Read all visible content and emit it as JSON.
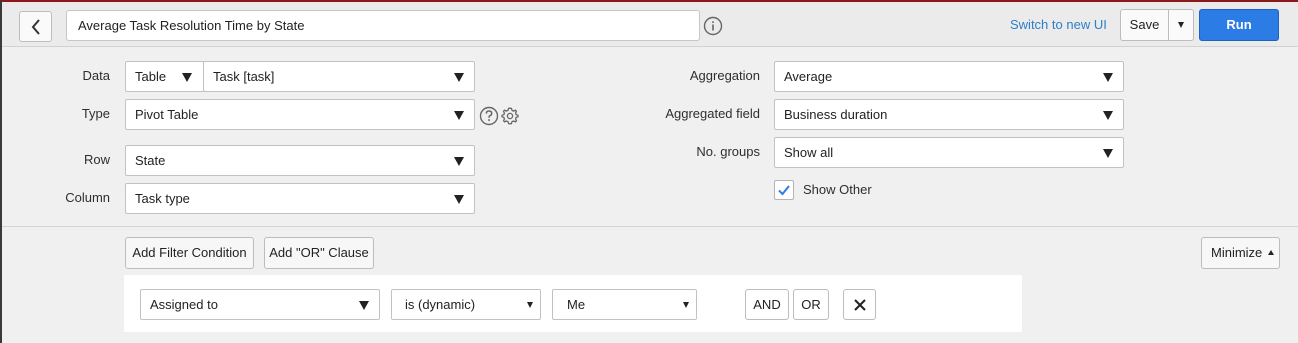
{
  "header": {
    "report_title": "Average Task Resolution Time by State",
    "switch_link": "Switch to new UI",
    "save_label": "Save",
    "run_label": "Run"
  },
  "config": {
    "data_label": "Data",
    "data_source_type": "Table",
    "data_table": "Task [task]",
    "type_label": "Type",
    "type_value": "Pivot Table",
    "row_label": "Row",
    "row_value": "State",
    "column_label": "Column",
    "column_value": "Task type",
    "aggregation_label": "Aggregation",
    "aggregation_value": "Average",
    "aggregated_field_label": "Aggregated field",
    "aggregated_field_value": "Business duration",
    "groups_label": "No. groups",
    "groups_value": "Show all",
    "show_other_label": "Show Other",
    "show_other_checked": true
  },
  "filters": {
    "add_condition_label": "Add Filter Condition",
    "add_or_label": "Add \"OR\" Clause",
    "minimize_label": "Minimize",
    "condition": {
      "field": "Assigned to",
      "operator": "is (dynamic)",
      "value": "Me",
      "and_label": "AND",
      "or_label": "OR"
    }
  },
  "colors": {
    "accent": "#2c7ce5",
    "link": "#2d7ecb",
    "check": "#2c7ce5",
    "top_border": "#8b1a1a"
  }
}
